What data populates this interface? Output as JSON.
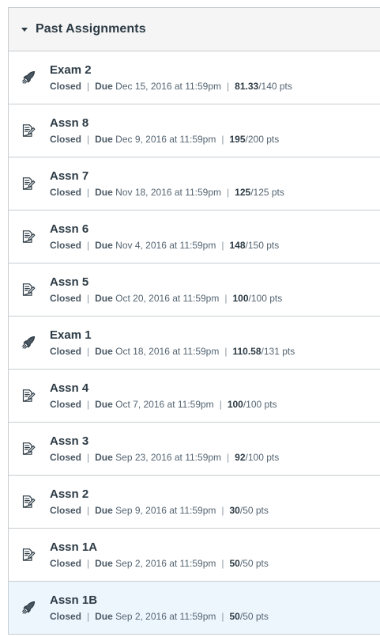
{
  "group": {
    "title": "Past Assignments"
  },
  "labels": {
    "closed": "Closed",
    "due": "Due",
    "separator": "|",
    "pts_suffix": " pts"
  },
  "assignments": [
    {
      "name": "Exam 2",
      "icon": "quiz-rocket-icon",
      "due": "Dec 15, 2016 at 11:59pm",
      "score": "81.33",
      "total": "/140",
      "selected": false
    },
    {
      "name": "Assn 8",
      "icon": "assignment-edit-icon",
      "due": "Dec 9, 2016 at 11:59pm",
      "score": "195",
      "total": "/200",
      "selected": false
    },
    {
      "name": "Assn 7",
      "icon": "assignment-edit-icon",
      "due": "Nov 18, 2016 at 11:59pm",
      "score": "125",
      "total": "/125",
      "selected": false
    },
    {
      "name": "Assn 6",
      "icon": "assignment-edit-icon",
      "due": "Nov 4, 2016 at 11:59pm",
      "score": "148",
      "total": "/150",
      "selected": false
    },
    {
      "name": "Assn 5",
      "icon": "assignment-edit-icon",
      "due": "Oct 20, 2016 at 11:59pm",
      "score": "100",
      "total": "/100",
      "selected": false
    },
    {
      "name": "Exam 1",
      "icon": "quiz-rocket-icon",
      "due": "Oct 18, 2016 at 11:59pm",
      "score": "110.58",
      "total": "/131",
      "selected": false
    },
    {
      "name": "Assn 4",
      "icon": "assignment-edit-icon",
      "due": "Oct 7, 2016 at 11:59pm",
      "score": "100",
      "total": "/100",
      "selected": false
    },
    {
      "name": "Assn 3",
      "icon": "assignment-edit-icon",
      "due": "Sep 23, 2016 at 11:59pm",
      "score": "92",
      "total": "/100",
      "selected": false
    },
    {
      "name": "Assn 2",
      "icon": "assignment-edit-icon",
      "due": "Sep 9, 2016 at 11:59pm",
      "score": "30",
      "total": "/50",
      "selected": false
    },
    {
      "name": "Assn 1A",
      "icon": "assignment-edit-icon",
      "due": "Sep 2, 2016 at 11:59pm",
      "score": "50",
      "total": "/50",
      "selected": false
    },
    {
      "name": "Assn 1B",
      "icon": "quiz-rocket-icon",
      "due": "Sep 2, 2016 at 11:59pm",
      "score": "50",
      "total": "/50",
      "selected": true
    }
  ],
  "colors": {
    "header_bg": "#f5f5f5",
    "border": "#c7cdd1",
    "selected_bg": "#eef6fd",
    "text": "#2d3b45"
  }
}
